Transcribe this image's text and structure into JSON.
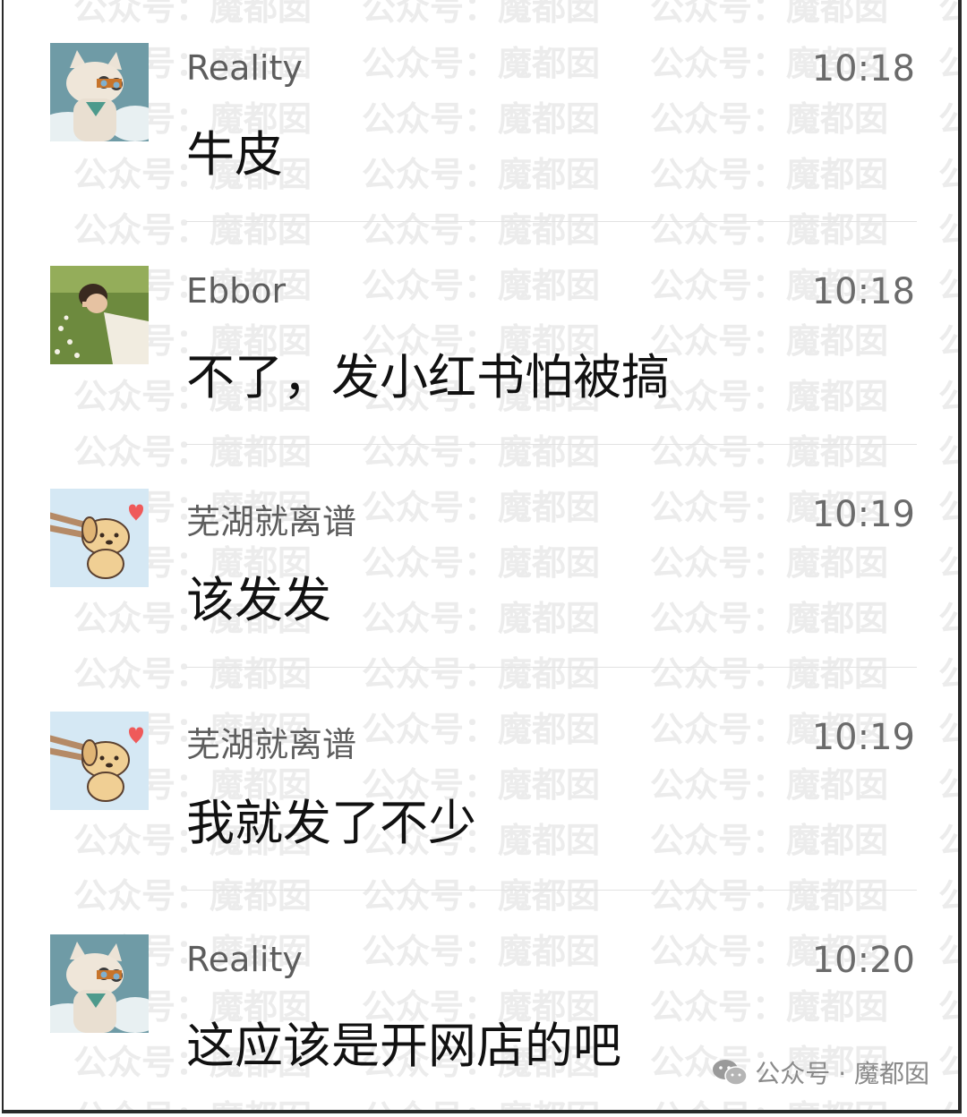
{
  "messages": [
    {
      "sender": "Reality",
      "time": "10:18",
      "text": "牛皮",
      "avatar": "cat-with-binoculars-avatar"
    },
    {
      "sender": "Ebbor",
      "time": "10:18",
      "text": "不了，发小红书怕被搞",
      "avatar": "boy-lying-in-grass-avatar"
    },
    {
      "sender": "芜湖就离谱",
      "time": "10:19",
      "text": "该发发",
      "avatar": "puppy-with-chopsticks-avatar"
    },
    {
      "sender": "芜湖就离谱",
      "time": "10:19",
      "text": "我就发了不少",
      "avatar": "puppy-with-chopsticks-avatar"
    },
    {
      "sender": "Reality",
      "time": "10:20",
      "text": "这应该是开网店的吧",
      "avatar": "cat-with-binoculars-avatar"
    }
  ],
  "watermark": {
    "text": "公众号：魔都囡",
    "footer_text": "公众号 · 魔都囡",
    "icon": "wechat-icon"
  },
  "colors": {
    "background": "#ffffff",
    "sender": "#5d5d5d",
    "time": "#6b6b6b",
    "message": "#111111",
    "watermark": "#ececec"
  }
}
